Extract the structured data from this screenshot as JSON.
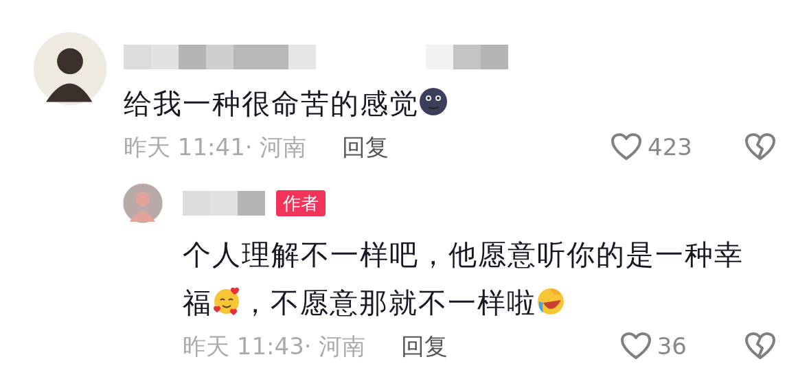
{
  "comments": [
    {
      "segments": [
        {
          "kind": "text",
          "text": "给我一种很命苦的感觉"
        },
        {
          "kind": "moonface"
        }
      ],
      "meta": "昨天 11:41· 河南",
      "reply_label": "回复",
      "likes": "423",
      "children": [
        {
          "badge": "作者",
          "segments": [
            {
              "kind": "text",
              "text": "个人理解不一样吧，他愿意听你的是一种幸福"
            },
            {
              "kind": "hearts"
            },
            {
              "kind": "text",
              "text": "，不愿意那就不一样啦"
            },
            {
              "kind": "rofl"
            }
          ],
          "meta": "昨天 11:43· 河南",
          "reply_label": "回复",
          "likes": "36"
        }
      ]
    }
  ]
}
